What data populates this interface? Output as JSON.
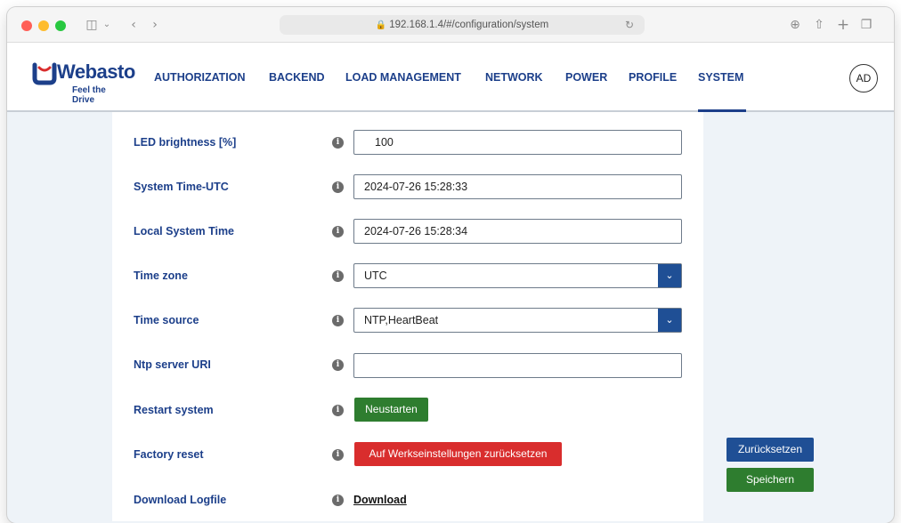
{
  "browser": {
    "url": "192.168.1.4/#/configuration/system"
  },
  "app": {
    "logo_text": "Webasto",
    "logo_tagline": "Feel the Drive",
    "nav": [
      "AUTHORIZATION",
      "BACKEND",
      "LOAD MANAGEMENT",
      "NETWORK",
      "POWER",
      "PROFILE",
      "SYSTEM"
    ],
    "active_nav": "SYSTEM",
    "user_initials": "AD"
  },
  "settings": {
    "led_brightness": {
      "label": "LED brightness [%]",
      "value": "100"
    },
    "system_time_utc": {
      "label": "System Time-UTC",
      "value": "2024-07-26 15:28:33"
    },
    "local_system_time": {
      "label": "Local System Time",
      "value": "2024-07-26 15:28:34"
    },
    "time_zone": {
      "label": "Time zone",
      "value": "UTC"
    },
    "time_source": {
      "label": "Time source",
      "value": "NTP,HeartBeat"
    },
    "ntp_server_uri": {
      "label": "Ntp server URI",
      "value": ""
    },
    "restart_system": {
      "label": "Restart system",
      "button": "Neustarten"
    },
    "factory_reset": {
      "label": "Factory reset",
      "button": "Auf Werkseinstellungen zurücksetzen"
    },
    "download_logfile": {
      "label": "Download Logfile",
      "link": "Download"
    }
  },
  "actions": {
    "reset_label": "Zurücksetzen",
    "save_label": "Speichern"
  },
  "colors": {
    "brand_blue": "#1c3f8a",
    "button_green": "#2e7d2f",
    "button_red": "#d92d2d",
    "button_blue": "#1f4f95",
    "page_bg": "#eef3f8"
  }
}
